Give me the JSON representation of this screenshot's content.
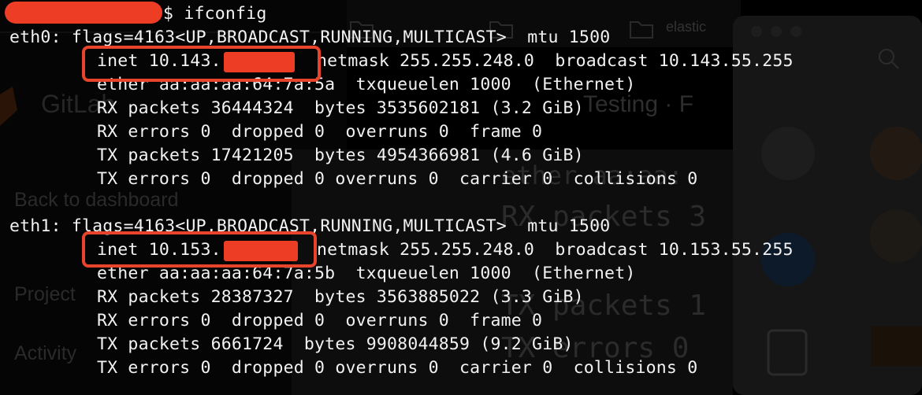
{
  "terminal": {
    "prompt_symbol": "$",
    "command": "ifconfig",
    "eth0": {
      "header": "eth0: flags=4163<UP,BROADCAST,RUNNING,MULTICAST>  mtu 1500",
      "inet_prefix": "inet 10.143.",
      "inet_rest": "netmask 255.255.248.0  broadcast 10.143.55.255",
      "ether": "ether aa:aa:aa:64:7a:5a  txqueuelen 1000  (Ethernet)",
      "rx_packets": "RX packets 36444324  bytes 3535602181 (3.2 GiB)",
      "rx_errors": "RX errors 0  dropped 0  overruns 0  frame 0",
      "tx_packets": "TX packets 17421205  bytes 4954366981 (4.6 GiB)",
      "tx_errors": "TX errors 0  dropped 0 overruns 0  carrier 0  collisions 0"
    },
    "eth1": {
      "header": "eth1: flags=4163<UP,BROADCAST,RUNNING,MULTICAST>  mtu 1500",
      "inet_prefix": "inet 10.153.",
      "inet_rest": "netmask 255.255.248.0  broadcast 10.153.55.255",
      "ether": "ether aa:aa:aa:64:7a:5b  txqueuelen 1000  (Ethernet)",
      "rx_packets": "RX packets 28387327  bytes 3563885022 (3.3 GiB)",
      "rx_errors": "RX errors 0  dropped 0  overruns 0  frame 0",
      "tx_packets": "TX packets 6661724  bytes 9908044859 (9.2 GiB)",
      "tx_errors": "TX errors 0  dropped 0 overruns 0  carrier 0  collisions 0"
    }
  },
  "background": {
    "bookmarks": [
      "elastic"
    ],
    "app_name": "GitLab",
    "page_title": "Testing · F",
    "sidebar_items": [
      "Back to dashboard",
      "Project",
      "Activity"
    ],
    "echo_lines": [
      "ether aa:aa:",
      "RX packets 3",
      "TX packets 1",
      "TX errors 0"
    ]
  },
  "colors": {
    "terminal_bg": "#000000",
    "terminal_text": "#f2f2f2",
    "redaction": "#ee3d25",
    "highlight_border": "#e8432b"
  }
}
